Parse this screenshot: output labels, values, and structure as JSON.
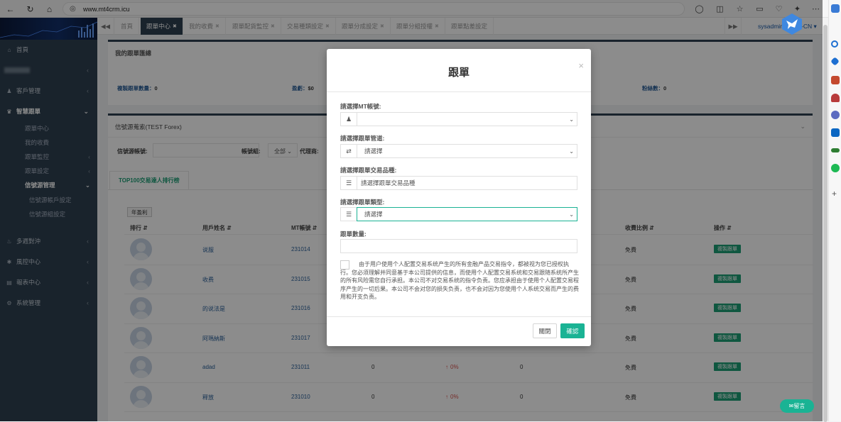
{
  "browser": {
    "url": "www.mt4crm.icu"
  },
  "sidebar": {
    "items": [
      {
        "icon": "home-icon",
        "label": "首頁"
      },
      {
        "icon": "blurred-icon",
        "label": ""
      },
      {
        "icon": "user-icon",
        "label": "客戶管理"
      },
      {
        "icon": "users-icon",
        "label": "智慧跟單"
      }
    ],
    "sub_items": [
      "跟單中心",
      "我的收費",
      "跟單監控",
      "跟單設定",
      "信號源管理"
    ],
    "sub_sub_items": [
      "信號源帳戶設定",
      "信號源組設定"
    ],
    "bottom_items": [
      {
        "icon": "bell-icon",
        "label": "多週對沖"
      },
      {
        "icon": "shield-icon",
        "label": "風控中心"
      },
      {
        "icon": "chart-icon",
        "label": "報表中心"
      },
      {
        "icon": "cogs-icon",
        "label": "系統管理"
      }
    ]
  },
  "tabs": [
    "首頁",
    "跟單中心",
    "我的收費",
    "跟單配貨監控",
    "交易種類設定",
    "跟單分成設定",
    "跟單分組授權",
    "跟單點差設定"
  ],
  "user": {
    "name": "sysadmin",
    "lang": "-CN"
  },
  "panel1": {
    "title": "我的跟單匯總",
    "stats": [
      {
        "label": "複製跟單數量：",
        "value": "0"
      },
      {
        "label": "盈虧：",
        "value": "$0"
      },
      {
        "label": "粉絲數：",
        "value": "0"
      }
    ]
  },
  "panel2": {
    "title": "信號源蒐索(TEST Forex)",
    "filter_account_label": "信號源帳號:",
    "filter_group_label": "帳號組:",
    "filter_group_value": "全部",
    "filter_agent_label": "代理商:",
    "tab_label": "TOP100交易達人排行榜",
    "year_btn": "年盈利",
    "columns": [
      "排行",
      "用戶姓名",
      "MT帳號",
      "收費比例",
      "操作"
    ],
    "rows": [
      {
        "name": "说服",
        "mt": "231014",
        "v1": "",
        "pct": "",
        "v2": "",
        "fee": "免費",
        "action": "複製跟單"
      },
      {
        "name": "收费",
        "mt": "231015",
        "v1": "",
        "pct": "",
        "v2": "",
        "fee": "免費",
        "action": "複製跟單"
      },
      {
        "name": "的说法是",
        "mt": "231016",
        "v1": "",
        "pct": "",
        "v2": "",
        "fee": "免費",
        "action": "複製跟單"
      },
      {
        "name": "阿瑪納斯",
        "mt": "231017",
        "v1": "",
        "pct": "",
        "v2": "",
        "fee": "免費",
        "action": "複製跟單"
      },
      {
        "name": "adad",
        "mt": "231011",
        "v1": "0",
        "pct": "0%",
        "v2": "0",
        "fee": "免費",
        "action": "複製跟單"
      },
      {
        "name": "释放",
        "mt": "231010",
        "v1": "0",
        "pct": "0%",
        "v2": "0",
        "fee": "免費",
        "action": "複製跟單"
      }
    ]
  },
  "modal": {
    "title": "跟單",
    "close_symbol": "×",
    "mt_label": "請選擇MT帳號:",
    "mt_value": "",
    "channel_label": "請選擇跟單管道:",
    "channel_value": "請選擇",
    "product_label": "請選擇跟單交易品種:",
    "product_placeholder": "請選擇跟單交易品種",
    "type_label": "請選擇跟單類型:",
    "type_value": "請選擇",
    "qty_label": "跟單數量:",
    "qty_value": "",
    "agreement": "由于用户使用个人配置交易系统产生的所有金融产品交易指令，都被视为您已授权执行。您必须理解并同意基于本公司提供的信息，而使用个人配置交易系统和交易跟随系统所产生的所有风险需您自行承担。本公司不对交易系统的指令负责。您应承担由于使用个人配置交易程序产生的一切后果。本公司不会对您的损失负责，也不会对因为您使用个人系统交易而产生的费用和开支负责。",
    "close_btn": "關閉",
    "confirm_btn": "確認"
  },
  "chat_btn": "留言",
  "colors": {
    "sidebar": "#2f4050",
    "accent": "#1ab394",
    "copy_btn": "#1c9e75",
    "loss": "#d9534f"
  }
}
